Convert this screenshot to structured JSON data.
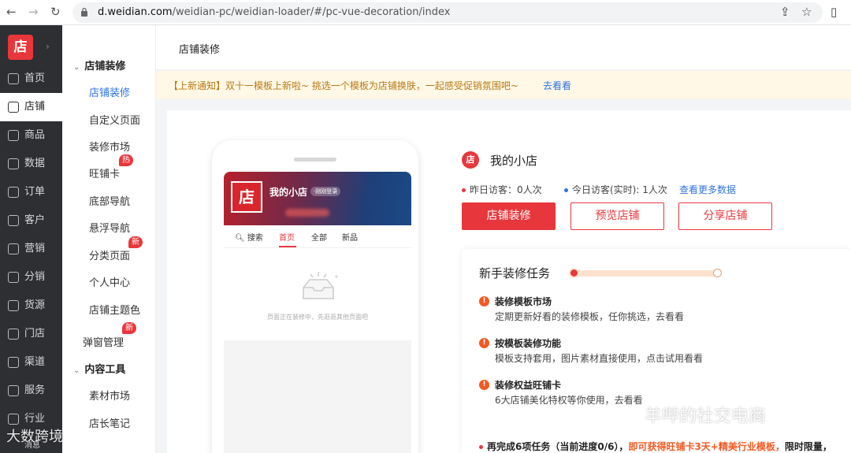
{
  "browser": {
    "url_host": "d.weidian.com",
    "url_path": "/weidian-pc/weidian-loader/#/pc-vue-decoration/index"
  },
  "sidebar": {
    "logo": "店",
    "items": [
      {
        "label": "首页",
        "icon": "home-icon"
      },
      {
        "label": "店铺",
        "icon": "store-icon",
        "active": true
      },
      {
        "label": "商品",
        "icon": "bag-icon"
      },
      {
        "label": "数据",
        "icon": "chart-icon"
      },
      {
        "label": "订单",
        "icon": "order-icon"
      },
      {
        "label": "客户",
        "icon": "user-icon"
      },
      {
        "label": "营销",
        "icon": "megaphone-icon"
      },
      {
        "label": "分销",
        "icon": "distribution-icon"
      },
      {
        "label": "货源",
        "icon": "supply-icon"
      },
      {
        "label": "门店",
        "icon": "shop-icon"
      },
      {
        "label": "渠道",
        "icon": "channel-icon"
      },
      {
        "label": "服务",
        "icon": "heart-icon"
      },
      {
        "label": "行业",
        "icon": "industry-icon"
      }
    ],
    "bottom_label": "消息"
  },
  "submenu": {
    "group1": "店铺装修",
    "items": [
      "店铺装修",
      "自定义页面",
      "装修市场",
      "旺铺卡",
      "底部导航",
      "悬浮导航",
      "分类页面",
      "个人中心",
      "店铺主题色"
    ],
    "popup_mgmt": "弹窗管理",
    "group2": "内容工具",
    "items2": [
      "素材市场",
      "店长笔记"
    ],
    "badge_hot": "热",
    "badge_new": "新"
  },
  "page": {
    "title": "店铺装修",
    "notice": "【上新通知】双十一模板上新啦~ 挑选一个模板为店铺换肤，一起感受促销氛围吧~",
    "notice_link": "去看看"
  },
  "phone": {
    "logo": "店",
    "shop_name": "我的小店",
    "login_tag": "·刚刚登录",
    "tabs": [
      "搜索",
      "首页",
      "全部",
      "新品"
    ],
    "empty_text": "页面正在装修中，先逛逛其他页面吧"
  },
  "shop": {
    "icon": "店",
    "name": "我的小店",
    "yesterday": "昨日访客：0人次",
    "today": "今日访客(实时): 1人次",
    "more": "查看更多数据",
    "btn_decorate": "店铺装修",
    "btn_preview": "预览店铺",
    "btn_share": "分享店铺"
  },
  "tasks": {
    "title": "新手装修任务",
    "progress": 0,
    "items": [
      {
        "title": "装修模板市场",
        "desc": "定期更新好看的装修模板，任你挑选，去看看"
      },
      {
        "title": "按模板装修功能",
        "desc": "模板支持套用，图片素材直接使用，点击试用看看"
      },
      {
        "title": "装修权益旺铺卡",
        "desc": "6大店铺美化特权等你使用，去看看"
      }
    ],
    "footer_prefix": "再完成6项任务（当前进度0/6），",
    "footer_highlight": "即可获得旺铺卡3天+精美行业模板，",
    "footer_suffix": "限时限量，"
  },
  "watermarks": {
    "right": "羊哔的社交电商",
    "left": "大数跨境"
  },
  "colors": {
    "accent": "#e8373c",
    "link": "#2f73e0",
    "sidebar": "#2d2f33",
    "notice_bg": "#fff8e6"
  }
}
